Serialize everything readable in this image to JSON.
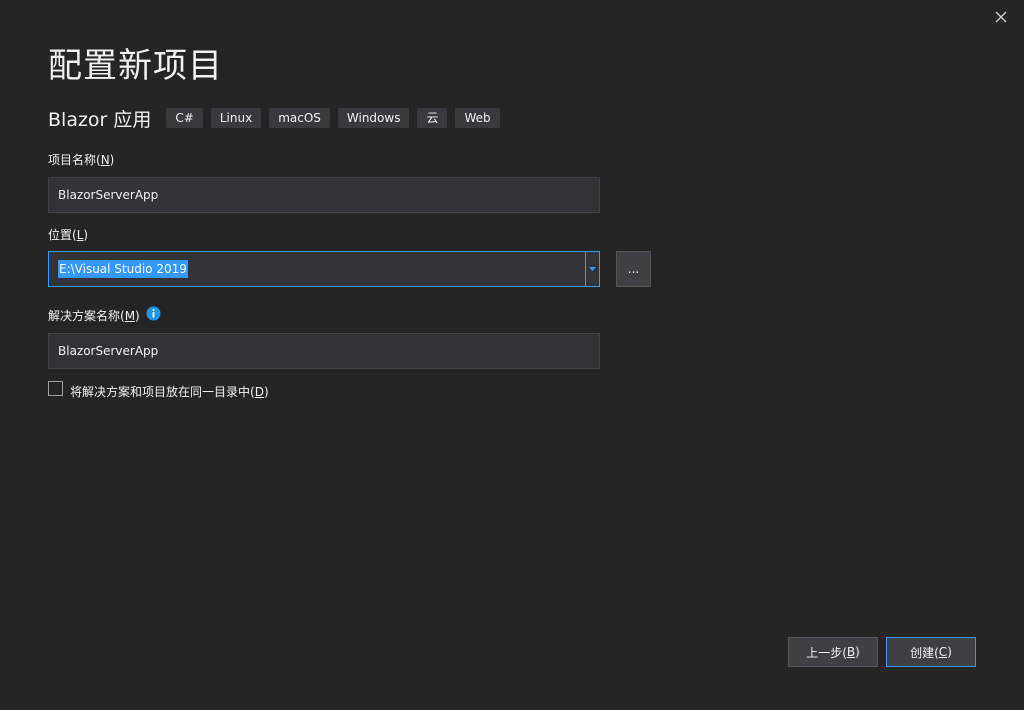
{
  "header": {
    "title": "配置新项目"
  },
  "template": {
    "name": "Blazor 应用",
    "tags": [
      "C#",
      "Linux",
      "macOS",
      "Windows",
      "云",
      "Web"
    ]
  },
  "form": {
    "project_name": {
      "label": "项目名称(",
      "mnemonic": "N",
      "label_end": ")",
      "value": "BlazorServerApp"
    },
    "location": {
      "label": "位置(",
      "mnemonic": "L",
      "label_end": ")",
      "value": "E:\\Visual Studio 2019",
      "browse_label": "..."
    },
    "solution_name": {
      "label": "解决方案名称(",
      "mnemonic": "M",
      "label_end": ")",
      "value": "BlazorServerApp"
    },
    "same_dir": {
      "label": "将解决方案和项目放在同一目录中(",
      "mnemonic": "D",
      "label_end": ")",
      "checked": false
    }
  },
  "footer": {
    "back": {
      "label": "上一步(",
      "mnemonic": "B",
      "label_end": ")"
    },
    "create": {
      "label": "创建(",
      "mnemonic": "C",
      "label_end": ")"
    }
  },
  "icons": {
    "close": "close-icon",
    "info": "info-icon",
    "dropdown": "chevron-down-icon"
  },
  "colors": {
    "background": "#252526",
    "input_background": "#333337",
    "accent": "#3399ff",
    "button_background": "#3f3f46",
    "text": "#f1f1f1"
  }
}
